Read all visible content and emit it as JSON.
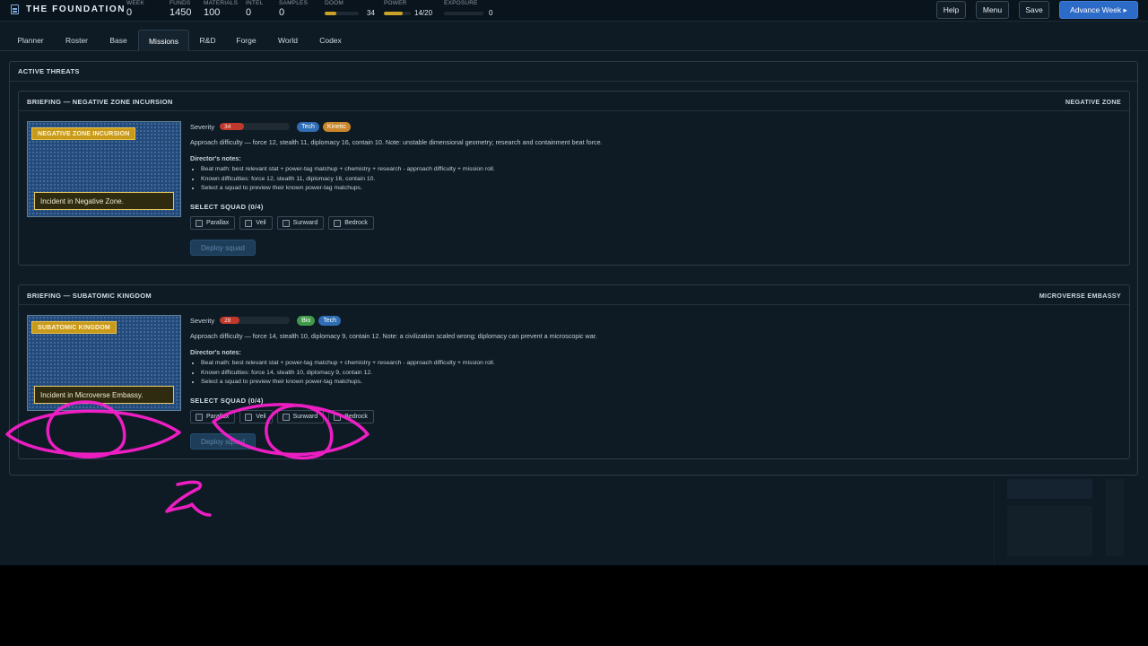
{
  "header": {
    "title": "THE FOUNDATION",
    "stats": [
      {
        "label": "WEEK",
        "value": "0"
      },
      {
        "label": "FUNDS",
        "value": "1450"
      },
      {
        "label": "MATERIALS",
        "value": "100"
      },
      {
        "label": "INTEL",
        "value": "0"
      },
      {
        "label": "SAMPLES",
        "value": "0"
      }
    ],
    "meters": {
      "doom": {
        "label": "DOOM",
        "value": "34",
        "fraction": 0.34
      },
      "power": {
        "label": "POWER",
        "value": "14/20",
        "fraction": 0.7
      },
      "exposure": {
        "label": "EXPOSURE",
        "value": "0",
        "fraction": 0
      }
    },
    "buttons": {
      "help": "Help",
      "menu": "Menu",
      "save": "Save",
      "advance": "Advance Week ▸"
    }
  },
  "tabs": [
    "Planner",
    "Roster",
    "Base",
    "Missions",
    "R&D",
    "Forge",
    "World",
    "Codex"
  ],
  "active_tab": "Missions",
  "panel": {
    "title": "ACTIVE THREATS",
    "missions": [
      {
        "title": "BRIEFING — NEGATIVE ZONE INCURSION",
        "location": "NEGATIVE ZONE",
        "badge": "NEGATIVE ZONE INCURSION",
        "caption": "Incident in Negative Zone.",
        "severity_label": "Severity",
        "severity": "34",
        "severity_fraction": 0.34,
        "tags": [
          {
            "name": "Tech",
            "color": "#2f6db5"
          },
          {
            "name": "Kinetic",
            "color": "#c9862a"
          }
        ],
        "approach": "Approach difficulty — force 12, stealth 11, diplomacy 16, contain 10. Note: unstable dimensional geometry; research and containment beat force.",
        "notes_heading": "Director's notes:",
        "notes": [
          "Beat math: best relevant stat + power-tag matchup + chemistry + research - approach difficulty + mission roll.",
          "Known difficulties: force 12, stealth 11, diplomacy 16, contain 10.",
          "Select a squad to preview their known power-tag matchups."
        ],
        "squad_heading": "SELECT SQUAD (0/4)",
        "squads": [
          "Parallax",
          "Veil",
          "Sunward",
          "Bedrock"
        ],
        "deploy": "Deploy squad"
      },
      {
        "title": "BRIEFING — SUBATOMIC KINGDOM",
        "location": "MICROVERSE EMBASSY",
        "badge": "SUBATOMIC KINGDOM",
        "caption": "Incident in Microverse Embassy.",
        "severity_label": "Severity",
        "severity": "28",
        "severity_fraction": 0.28,
        "tags": [
          {
            "name": "Bio",
            "color": "#3f9a4a"
          },
          {
            "name": "Tech",
            "color": "#2f6db5"
          }
        ],
        "approach": "Approach difficulty — force 14, stealth 10, diplomacy 9, contain 12. Note: a civilization scaled wrong; diplomacy can prevent a microscopic war.",
        "notes_heading": "Director's notes:",
        "notes": [
          "Beat math: best relevant stat + power-tag matchup + chemistry + research - approach difficulty + mission roll.",
          "Known difficulties: force 14, stealth 10, diplomacy 9, contain 12.",
          "Select a squad to preview their known power-tag matchups."
        ],
        "squad_heading": "SELECT SQUAD (0/4)",
        "squads": [
          "Parallax",
          "Veil",
          "Sunward",
          "Bedrock"
        ],
        "deploy": "Deploy squad"
      }
    ]
  },
  "colors": {
    "accent": "#2d6bc9",
    "gold": "#c99a1a",
    "severity": "#c0392b",
    "ink": "#ff1fd0"
  }
}
